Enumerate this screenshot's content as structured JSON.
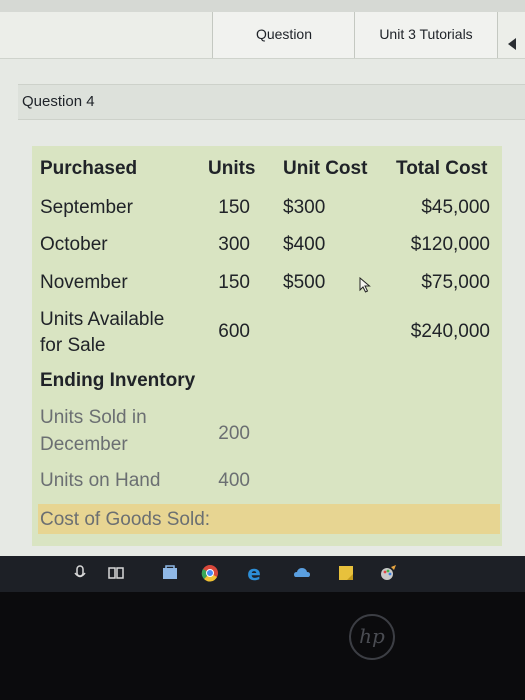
{
  "tabs": {
    "question_label": "Question",
    "unit3_label": "Unit 3 Tutorials"
  },
  "question": {
    "title": "Question 4"
  },
  "table": {
    "headers": {
      "purchased": "Purchased",
      "units": "Units",
      "unit_cost": "Unit Cost",
      "total_cost": "Total Cost"
    },
    "rows": [
      {
        "month": "September",
        "units": "150",
        "unit_cost": "$300",
        "total_cost": "$45,000"
      },
      {
        "month": "October",
        "units": "300",
        "unit_cost": "$400",
        "total_cost": "$120,000"
      },
      {
        "month": "November",
        "units": "150",
        "unit_cost": "$500",
        "total_cost": "$75,000"
      }
    ],
    "available": {
      "label_line1": "Units Available",
      "label_line2": "for Sale",
      "units": "600",
      "total_cost": "$240,000"
    },
    "ending_inventory_label": "Ending Inventory",
    "sold": {
      "label_line1": "Units Sold in",
      "label_line2": "December",
      "units": "200"
    },
    "on_hand": {
      "label": "Units on Hand",
      "units": "400"
    },
    "cogs_label": "Cost of Goods Sold:"
  },
  "taskbar": {
    "icons": [
      "microphone-icon",
      "task-view-icon",
      "store-icon",
      "chrome-icon",
      "edge-icon",
      "cloud-icon",
      "sticky-notes-icon",
      "paint-icon"
    ]
  },
  "colors": {
    "panel": "#d9e4c2",
    "highlight": "#e7d592",
    "taskbar": "#1d2026"
  },
  "logo_text": "hp"
}
